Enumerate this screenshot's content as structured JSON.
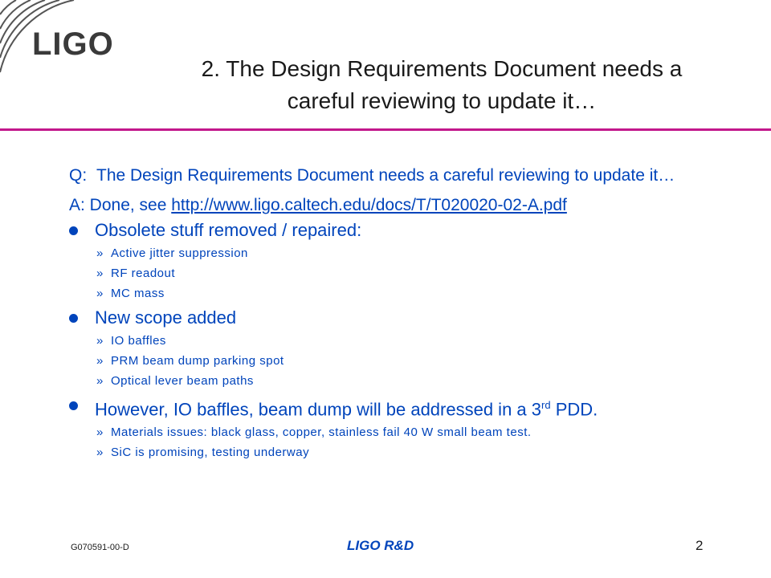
{
  "header": {
    "logo_text": "LIGO",
    "title_line1": "2. The Design Requirements Document needs a",
    "title_line2": "careful reviewing to update it…"
  },
  "body": {
    "q_label": "Q:",
    "q_text": "The Design Requirements Document needs a careful reviewing to update it…",
    "a_prefix": "A: Done, see ",
    "a_link": "http://www.ligo.caltech.edu/docs/T/T020020-02-A.pdf",
    "bullets": [
      {
        "text": "Obsolete stuff removed / repaired:",
        "subs": [
          "Active jitter suppression",
          "RF readout",
          "MC mass"
        ]
      },
      {
        "text": "New scope added",
        "subs": [
          "IO baffles",
          "PRM beam dump parking spot",
          "Optical lever beam paths"
        ]
      },
      {
        "text_before": "However, IO baffles, beam dump will be addressed in a 3",
        "superscript": "rd",
        "text_after": " PDD.",
        "subs": [
          "Materials issues: black glass, copper, stainless fail 40 W small beam test.",
          "SiC is promising, testing underway"
        ]
      }
    ],
    "sub_marker": "»"
  },
  "footer": {
    "doc_id": "G070591-00-D",
    "center": "LIGO R&D",
    "page": "2"
  },
  "colors": {
    "accent_rule": "#c2188b",
    "body_text": "#0044bb"
  }
}
